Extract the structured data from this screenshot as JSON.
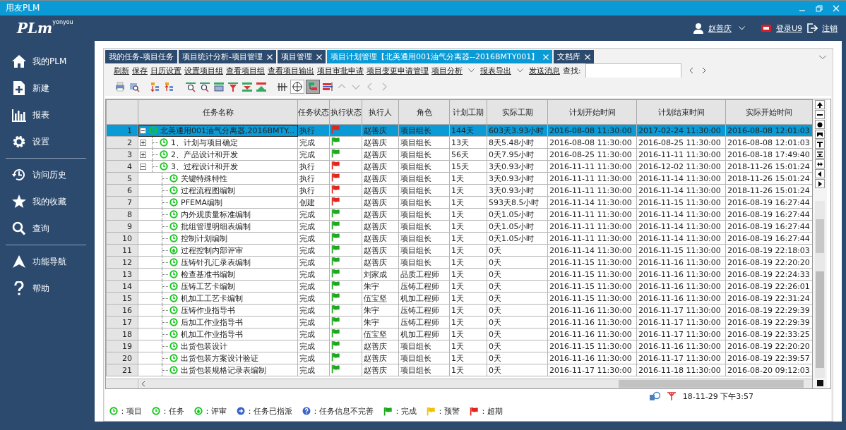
{
  "window": {
    "title": "用友PLM"
  },
  "logo": {
    "main": "PLm",
    "sup": "yonyou"
  },
  "user_bar": {
    "user": "赵善庆",
    "login_link": "登录U9",
    "logout_link": "注销"
  },
  "sidebar": {
    "groups": [
      [
        {
          "label": "我的PLM"
        },
        {
          "label": "新建"
        },
        {
          "label": "报表"
        },
        {
          "label": "设置"
        }
      ],
      [
        {
          "label": "访问历史"
        },
        {
          "label": "我的收藏"
        },
        {
          "label": "查询"
        }
      ],
      [
        {
          "label": "功能导航"
        },
        {
          "label": "帮助"
        }
      ]
    ]
  },
  "tabs": [
    {
      "label": "我的任务-项目任务",
      "closable": false,
      "selected": false
    },
    {
      "label": "项目统计分析-项目管理",
      "closable": true,
      "selected": false
    },
    {
      "label": "项目管理",
      "closable": true,
      "selected": false
    },
    {
      "label": "项目计划管理【北美通用001油气分离器--2016BMTY001】",
      "closable": true,
      "selected": true
    },
    {
      "label": "文档库",
      "closable": true,
      "selected": false
    }
  ],
  "actions": [
    {
      "label": "刷新",
      "dropdown": false
    },
    {
      "label": "保存",
      "dropdown": false
    },
    {
      "label": "日历设置",
      "dropdown": false
    },
    {
      "label": "设置项目组",
      "dropdown": false
    },
    {
      "label": "查看项目组",
      "dropdown": false
    },
    {
      "label": "查看项目输出",
      "dropdown": false
    },
    {
      "label": "项目审批申请",
      "dropdown": false
    },
    {
      "label": "项目变更申请管理",
      "dropdown": false
    },
    {
      "label": "项目分析",
      "dropdown": true
    },
    {
      "label": "报表导出",
      "dropdown": true
    },
    {
      "label": "发送消息",
      "dropdown": false
    }
  ],
  "search": {
    "label": "查找:"
  },
  "table": {
    "columns": [
      "任务名称",
      "任务状态",
      "执行状态",
      "执行人",
      "角色",
      "计划工期",
      "实际工期",
      "计划开始时间",
      "计划结束时间",
      "实际开始时间"
    ],
    "rows": [
      {
        "num": "1",
        "name": "北美通用001油气分离器,2016BMTY...",
        "kind": "project",
        "selected": true,
        "expanded": true,
        "task_status": "执行",
        "color": "#e0261f",
        "executor": "赵善庆",
        "role": "项目组长",
        "plan_duration": "144天",
        "actual_duration": "603天3.93小时",
        "plan_start": "2016-08-08 11:30:00",
        "plan_end": "2017-02-24 11:30:00",
        "actual_start": "2016-08-08 12:01:03",
        "children": [
          {
            "num": "2",
            "name": "1、计划与项目确定",
            "kind": "task",
            "selected": false,
            "expanded": false,
            "task_status": "完成",
            "color": "#1ea81e",
            "executor": "赵善庆",
            "role": "项目组长",
            "plan_duration": "13天",
            "actual_duration": "8天5.48小时",
            "plan_start": "2016-08-08 11:30:00",
            "plan_end": "2016-08-25 11:30:00",
            "actual_start": "2016-08-08 12:01:03"
          },
          {
            "num": "3",
            "name": "2、产品设计和开发",
            "kind": "task",
            "selected": false,
            "expanded": false,
            "task_status": "完成",
            "color": "#1ea81e",
            "executor": "赵善庆",
            "role": "项目组长",
            "plan_duration": "56天",
            "actual_duration": "0天7.95小时",
            "plan_start": "2016-08-25 11:30:00",
            "plan_end": "2016-11-11 11:30:00",
            "actual_start": "2016-08-18 17:49:40"
          },
          {
            "num": "4",
            "name": "3、过程设计和开发",
            "kind": "task",
            "selected": false,
            "expanded": true,
            "task_status": "执行",
            "color": "#e0261f",
            "executor": "赵善庆",
            "role": "项目组长",
            "plan_duration": "15天",
            "actual_duration": "3天0.93小时",
            "plan_start": "2016-11-11 11:30:00",
            "plan_end": "2016-12-02 11:30:00",
            "actual_start": "2018-11-26 15:01:24",
            "children": [
              {
                "num": "5",
                "name": "关键特殊特性",
                "kind": "task",
                "selected": false,
                "task_status": "执行",
                "color": "#e0261f",
                "executor": "赵善庆",
                "role": "项目组长",
                "plan_duration": "1天",
                "actual_duration": "3天0.93小时",
                "plan_start": "2016-11-11 11:30:00",
                "plan_end": "2016-11-14 11:30:00",
                "actual_start": "2018-11-26 15:01:24"
              },
              {
                "num": "6",
                "name": "过程流程图编制",
                "kind": "task",
                "selected": false,
                "task_status": "执行",
                "color": "#e0261f",
                "executor": "赵善庆",
                "role": "项目组长",
                "plan_duration": "1天",
                "actual_duration": "3天0.93小时",
                "plan_start": "2016-11-11 11:30:00",
                "plan_end": "2016-11-14 11:30:00",
                "actual_start": "2018-11-26 15:01:24"
              },
              {
                "num": "7",
                "name": "PFEMA编制",
                "kind": "task",
                "selected": false,
                "task_status": "创建",
                "color": "#e0261f",
                "executor": "赵善庆",
                "role": "项目组长",
                "plan_duration": "1天",
                "actual_duration": "593天8.5小时",
                "plan_start": "2016-11-14 11:30:00",
                "plan_end": "2016-11-15 11:30:00",
                "actual_start": "2016-08-19 16:27:44"
              },
              {
                "num": "8",
                "name": "内外观质量标准编制",
                "kind": "task",
                "selected": false,
                "task_status": "完成",
                "color": "#1ea81e",
                "executor": "赵善庆",
                "role": "项目组长",
                "plan_duration": "1天",
                "actual_duration": "0天1.05小时",
                "plan_start": "2016-11-11 11:30:00",
                "plan_end": "2016-11-14 11:30:00",
                "actual_start": "2016-08-19 16:27:44"
              },
              {
                "num": "9",
                "name": "批组管理明细表编制",
                "kind": "task",
                "selected": false,
                "task_status": "完成",
                "color": "#1ea81e",
                "executor": "赵善庆",
                "role": "项目组长",
                "plan_duration": "1天",
                "actual_duration": "0天1.05小时",
                "plan_start": "2016-11-11 11:30:00",
                "plan_end": "2016-11-14 11:30:00",
                "actual_start": "2016-08-19 16:27:44"
              },
              {
                "num": "10",
                "name": "控制计划编制",
                "kind": "task",
                "selected": false,
                "task_status": "完成",
                "color": "#1ea81e",
                "executor": "赵善庆",
                "role": "项目组长",
                "plan_duration": "1天",
                "actual_duration": "0天1.05小时",
                "plan_start": "2016-11-11 11:30:00",
                "plan_end": "2016-11-14 11:30:00",
                "actual_start": "2016-08-19 16:27:44"
              },
              {
                "num": "11",
                "name": "过程控制内部评审",
                "kind": "review",
                "selected": false,
                "task_status": "完成",
                "color": "#1ea81e",
                "executor": "赵善庆",
                "role": "项目组长",
                "plan_duration": "1天",
                "actual_duration": "0天",
                "plan_start": "2016-11-14 11:30:00",
                "plan_end": "2016-11-15 11:30:00",
                "actual_start": "2016-08-19 22:18:03"
              },
              {
                "num": "12",
                "name": "压铸针孔汇录表编制",
                "kind": "task",
                "selected": false,
                "task_status": "完成",
                "color": "#1ea81e",
                "executor": "赵善庆",
                "role": "项目组长",
                "plan_duration": "1天",
                "actual_duration": "0天",
                "plan_start": "2016-11-15 11:30:00",
                "plan_end": "2016-11-16 11:30:00",
                "actual_start": "2016-08-19 22:20:20"
              },
              {
                "num": "13",
                "name": "检查基准书编制",
                "kind": "task",
                "selected": false,
                "task_status": "完成",
                "color": "#1ea81e",
                "executor": "刘家成",
                "role": "品质工程师",
                "plan_duration": "1天",
                "actual_duration": "0天",
                "plan_start": "2016-11-15 11:30:00",
                "plan_end": "2016-11-16 11:30:00",
                "actual_start": "2016-08-19 22:24:33"
              },
              {
                "num": "14",
                "name": "压铸工艺卡编制",
                "kind": "task",
                "selected": false,
                "task_status": "完成",
                "color": "#1ea81e",
                "executor": "朱宇",
                "role": "压铸工程师",
                "plan_duration": "1天",
                "actual_duration": "0天",
                "plan_start": "2016-11-15 11:30:00",
                "plan_end": "2016-11-16 11:30:00",
                "actual_start": "2016-08-19 22:26:01"
              },
              {
                "num": "15",
                "name": "机加工工艺卡编制",
                "kind": "task",
                "selected": false,
                "task_status": "完成",
                "color": "#1ea81e",
                "executor": "伍宝坚",
                "role": "机加工程师",
                "plan_duration": "1天",
                "actual_duration": "0天",
                "plan_start": "2016-11-15 11:30:00",
                "plan_end": "2016-11-16 11:30:00",
                "actual_start": "2016-08-19 22:31:24"
              },
              {
                "num": "16",
                "name": "压铸作业指导书",
                "kind": "task",
                "selected": false,
                "task_status": "完成",
                "color": "#1ea81e",
                "executor": "朱宇",
                "role": "压铸工程师",
                "plan_duration": "1天",
                "actual_duration": "0天",
                "plan_start": "2016-11-16 11:30:00",
                "plan_end": "2016-11-17 11:30:00",
                "actual_start": "2016-08-19 22:29:39"
              },
              {
                "num": "17",
                "name": "后加工作业指导书",
                "kind": "task",
                "selected": false,
                "task_status": "完成",
                "color": "#1ea81e",
                "executor": "朱宇",
                "role": "压铸工程师",
                "plan_duration": "1天",
                "actual_duration": "0天",
                "plan_start": "2016-11-16 11:30:00",
                "plan_end": "2016-11-17 11:30:00",
                "actual_start": "2016-08-19 22:29:39"
              },
              {
                "num": "18",
                "name": "机加工作业指导书",
                "kind": "task",
                "selected": false,
                "task_status": "完成",
                "color": "#1ea81e",
                "executor": "伍宝坚",
                "role": "机加工程师",
                "plan_duration": "1天",
                "actual_duration": "0天",
                "plan_start": "2016-11-16 11:30:00",
                "plan_end": "2016-11-17 11:30:00",
                "actual_start": "2016-08-19 22:33:25"
              },
              {
                "num": "19",
                "name": "出货包装设计",
                "kind": "task",
                "selected": false,
                "task_status": "完成",
                "color": "#1ea81e",
                "executor": "赵善庆",
                "role": "项目组长",
                "plan_duration": "1天",
                "actual_duration": "0天",
                "plan_start": "2016-11-15 11:30:00",
                "plan_end": "2016-11-16 11:30:00",
                "actual_start": "2016-08-19 22:20:20"
              },
              {
                "num": "20",
                "name": "出货包装方案设计验证",
                "kind": "task",
                "selected": false,
                "task_status": "完成",
                "color": "#1ea81e",
                "executor": "赵善庆",
                "role": "项目组长",
                "plan_duration": "1天",
                "actual_duration": "0天",
                "plan_start": "2016-11-16 11:30:00",
                "plan_end": "2016-11-17 11:30:00",
                "actual_start": "2016-08-19 22:39:57"
              },
              {
                "num": "21",
                "name": "出货包装规格记录表编制",
                "kind": "task",
                "selected": false,
                "task_status": "完成",
                "color": "#1ea81e",
                "executor": "赵善庆",
                "role": "项目组长",
                "plan_duration": "1天",
                "actual_duration": "0天",
                "plan_start": "2016-11-17 11:30:00",
                "plan_end": "2016-11-18 11:30:00",
                "actual_start": "2016-08-20 09:12:03"
              }
            ]
          }
        ]
      }
    ]
  },
  "status": {
    "time": "18-11-29 下午3:57"
  },
  "legend": [
    {
      "kind": "project",
      "label": "：项目"
    },
    {
      "kind": "task",
      "label": "：任务"
    },
    {
      "kind": "review",
      "label": "：评审"
    },
    {
      "kind": "assigned",
      "label": "：任务已指派"
    },
    {
      "kind": "incomplete",
      "label": "：任务信息不完善"
    },
    {
      "kind": "complete",
      "label": "：完成"
    },
    {
      "kind": "warning",
      "label": "：预警"
    },
    {
      "kind": "overdue",
      "label": "：超期"
    }
  ]
}
